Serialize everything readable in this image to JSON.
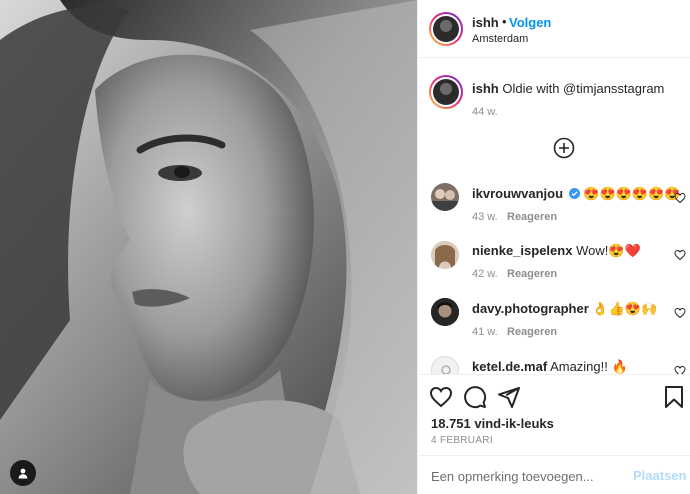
{
  "photo": {
    "alt": ""
  },
  "header": {
    "username": "ishh",
    "separator": "•",
    "follow_label": "Volgen",
    "location": "Amsterdam"
  },
  "caption": {
    "username": "ishh",
    "text": "Oldie with @timjansstagram",
    "time": "44 w."
  },
  "comments": [
    {
      "username": "ikvrouwvanjou",
      "verified": true,
      "text": "😍😍😍😍😍😍",
      "time": "43 w.",
      "reply_label": "Reageren"
    },
    {
      "username": "nienke_ispelenx",
      "verified": false,
      "text": "Wow!😍❤️",
      "time": "42 w.",
      "reply_label": "Reageren"
    },
    {
      "username": "davy.photographer",
      "verified": false,
      "text": "👌👍😍🙌",
      "time": "41 w.",
      "reply_label": "Reageren"
    },
    {
      "username": "ketel.de.maf",
      "verified": false,
      "text": "Amazing!! 🔥",
      "time": "",
      "reply_label": ""
    }
  ],
  "actions": {
    "likes": "18.751 vind-ik-leuks",
    "date": "4 FEBRUARI"
  },
  "add_comment": {
    "placeholder": "Een opmerking toevoegen...",
    "post_label": "Plaatsen"
  },
  "colors": {
    "link_blue": "#0095f6",
    "post_disabled": "#b3dbff",
    "verified": "#3897f0",
    "muted": "#8e8e8e"
  }
}
